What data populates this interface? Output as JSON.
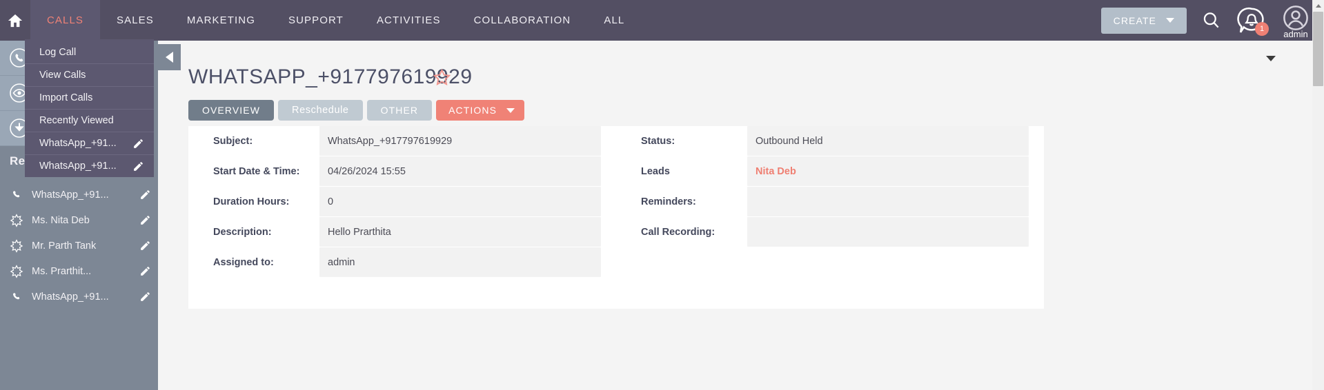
{
  "topnav": {
    "home_icon": "home-icon",
    "items": [
      {
        "label": "CALLS",
        "active": true
      },
      {
        "label": "SALES",
        "active": false
      },
      {
        "label": "MARKETING",
        "active": false
      },
      {
        "label": "SUPPORT",
        "active": false
      },
      {
        "label": "ACTIVITIES",
        "active": false
      },
      {
        "label": "COLLABORATION",
        "active": false
      },
      {
        "label": "ALL",
        "active": false
      }
    ],
    "create_label": "CREATE",
    "search_icon": "search-icon",
    "notification_icon": "notification-bell-icon",
    "notification_count": "1",
    "user_icon": "user-avatar-icon",
    "user_name": "admin"
  },
  "dropdown": {
    "items": [
      {
        "label": "Log Call",
        "editable": false
      },
      {
        "label": "View Calls",
        "editable": false
      },
      {
        "label": "Import Calls",
        "editable": false
      },
      {
        "label": "Recently Viewed",
        "editable": false
      },
      {
        "label": "WhatsApp_+91...",
        "editable": true
      },
      {
        "label": "WhatsApp_+91...",
        "editable": true
      }
    ]
  },
  "sidebar": {
    "quick_icons": [
      {
        "name": "phone-circle-icon"
      },
      {
        "name": "eye-circle-icon"
      },
      {
        "name": "download-circle-icon"
      }
    ],
    "recent_heading": "Recently Viewed",
    "recent_items": [
      {
        "label": "WhatsApp_+91...",
        "icon": "phone-icon"
      },
      {
        "label": "Ms. Nita Deb",
        "icon": "star-burst-icon"
      },
      {
        "label": "Mr. Parth Tank",
        "icon": "star-burst-icon"
      },
      {
        "label": "Ms. Prarthit...",
        "icon": "star-burst-icon"
      },
      {
        "label": "WhatsApp_+91...",
        "icon": "phone-icon"
      }
    ]
  },
  "main": {
    "collapse_icon": "collapse-left-icon",
    "header_caret_icon": "chevron-down-icon",
    "page_title": "WHATSAPP_+917797619929",
    "favorite_icon": "star-outline-icon",
    "tabs": [
      {
        "label": "OVERVIEW",
        "style": "sel"
      },
      {
        "label": "Reschedule",
        "style": "mixed"
      },
      {
        "label": "OTHER",
        "style": "unsel"
      },
      {
        "label": "ACTIONS",
        "style": "action"
      }
    ],
    "fields_left": [
      {
        "label": "Subject:",
        "value": "WhatsApp_+917797619929",
        "link": false
      },
      {
        "label": "Start Date & Time:",
        "value": "04/26/2024 15:55",
        "link": false
      },
      {
        "label": "Duration Hours:",
        "value": "0",
        "link": false
      },
      {
        "label": "Description:",
        "value": "Hello Prarthita",
        "link": false
      },
      {
        "label": "Assigned to:",
        "value": "admin",
        "link": false
      }
    ],
    "fields_right": [
      {
        "label": "Status:",
        "value": "Outbound Held",
        "link": false
      },
      {
        "label": "Leads",
        "value": "Nita Deb",
        "link": true
      },
      {
        "label": "Reminders:",
        "value": "",
        "link": false
      },
      {
        "label": "Call Recording:",
        "value": "",
        "link": false
      }
    ]
  },
  "colors": {
    "nav_bg": "#534f63",
    "accent": "#f08276",
    "sidebar_bg": "#7d8795",
    "tab_selected": "#717d8a",
    "tab_unselected": "#c0cad2",
    "field_bg": "#f2f2f2",
    "title_text": "#4c5067"
  }
}
